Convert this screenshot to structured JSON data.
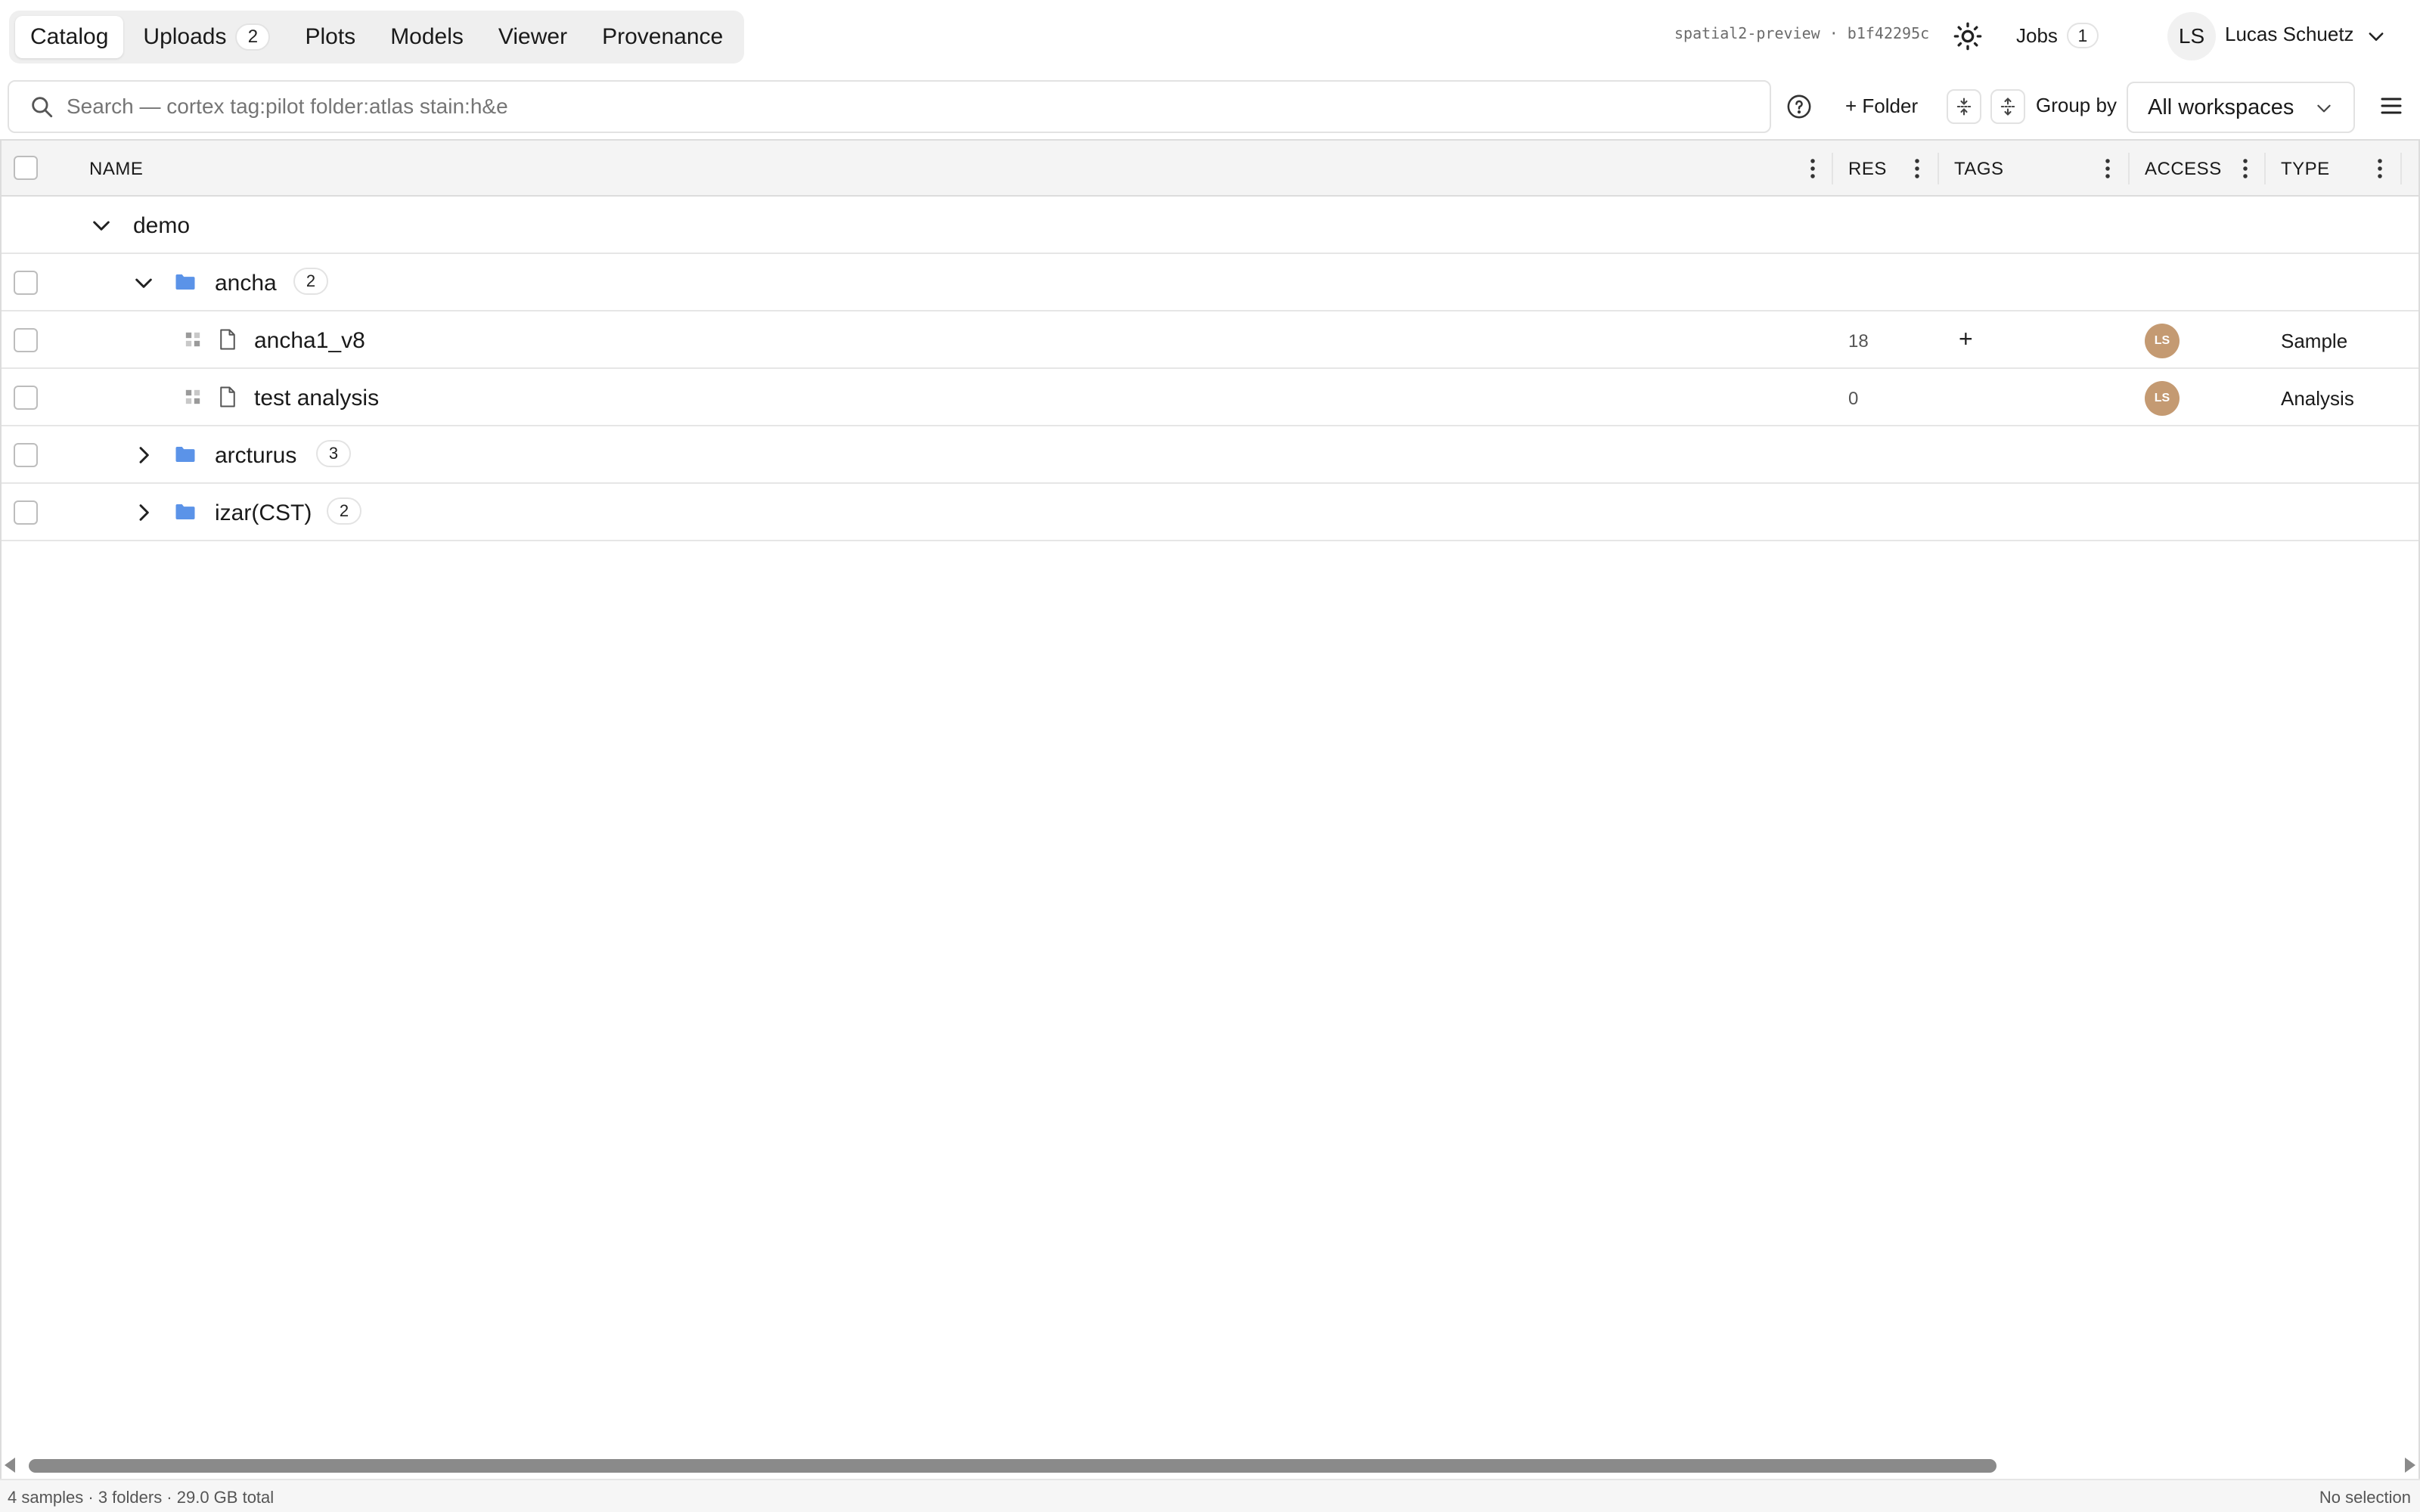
{
  "nav": {
    "tabs": [
      {
        "label": "Catalog",
        "active": true
      },
      {
        "label": "Uploads",
        "count": "2"
      },
      {
        "label": "Plots"
      },
      {
        "label": "Models"
      },
      {
        "label": "Viewer"
      },
      {
        "label": "Provenance"
      }
    ],
    "build": "spatial2-preview · b1f42295c",
    "theme_icon": "sun-icon",
    "jobs_label": "Jobs",
    "jobs_count": "1",
    "user_initials": "LS",
    "user_name": "Lucas Schuetz"
  },
  "toolbar": {
    "search_placeholder": "Search — cortex tag:pilot folder:atlas stain:h&e",
    "folder_button": "+ Folder",
    "group_by_label": "Group by",
    "group_by_value": "All workspaces"
  },
  "table": {
    "columns": {
      "name": "NAME",
      "res": "RES",
      "tags": "TAGS",
      "access": "ACCESS",
      "type": "TYPE"
    },
    "group": "demo",
    "rows": [
      {
        "name": "ancha",
        "count": "2",
        "kind": "folder",
        "expanded": true
      },
      {
        "name": "ancha1_v8",
        "kind": "sample",
        "res": "18",
        "tags_add": "+",
        "access": "LS",
        "type": "Sample"
      },
      {
        "name": "test analysis",
        "kind": "analysis",
        "res": "0",
        "access": "LS",
        "type": "Analysis"
      },
      {
        "name": "arcturus",
        "count": "3",
        "kind": "folder",
        "expanded": false
      },
      {
        "name": "izar(CST)",
        "count": "2",
        "kind": "folder",
        "expanded": false
      }
    ]
  },
  "footer": {
    "summary": "4 samples · 3 folders · 29.0 GB total",
    "selection": "No selection"
  },
  "colors": {
    "folder": "#5b93e8",
    "avatar": "#c49a72",
    "scroll_thumb": "#8a8a8a"
  }
}
